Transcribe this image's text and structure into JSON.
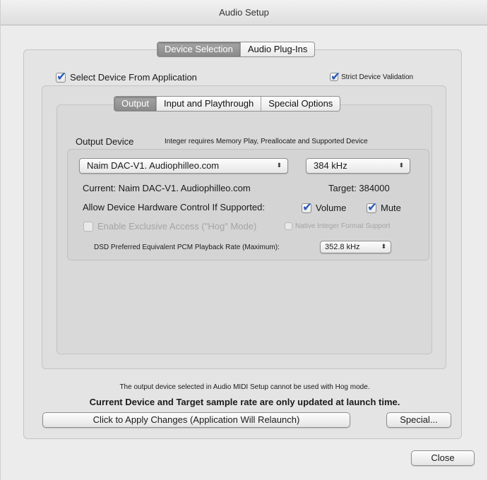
{
  "window": {
    "title": "Audio Setup"
  },
  "main_tabs": {
    "device_selection": "Device Selection",
    "audio_plugins": "Audio Plug-Ins"
  },
  "select_device_from_app": {
    "label": "Select Device From Application",
    "checked": true
  },
  "strict_validation": {
    "label": "Strict Device Validation",
    "checked": true
  },
  "sub_tabs": {
    "output": "Output",
    "input_playthrough": "Input and Playthrough",
    "special_options": "Special Options"
  },
  "output": {
    "heading": "Output Device",
    "integer_note": "Integer requires Memory Play, Preallocate and Supported Device",
    "device_popup": "Naim DAC-V1. Audiophilleo.com",
    "rate_popup": "384 kHz",
    "current_label": "Current: Naim DAC-V1. Audiophilleo.com",
    "target_label": "Target: 384000",
    "hw_control_label": "Allow Device Hardware Control If Supported:",
    "volume": {
      "label": "Volume",
      "checked": true
    },
    "mute": {
      "label": "Mute",
      "checked": true
    },
    "exclusive_access": {
      "label": "Enable Exclusive Access (\"Hog\" Mode)",
      "checked": false,
      "enabled": false
    },
    "native_integer": {
      "label": "Native Integer Format Support",
      "checked": false,
      "enabled": false
    },
    "dsd_label": "DSD Preferred Equivalent PCM Playback Rate (Maximum):",
    "dsd_popup": "352.8 kHz"
  },
  "notes": {
    "hog_note": "The output device selected in Audio MIDI Setup cannot be used with Hog mode.",
    "launch_note": "Current Device and Target sample rate are only updated at launch time."
  },
  "buttons": {
    "apply": "Click to Apply Changes (Application Will Relaunch)",
    "special": "Special...",
    "close": "Close"
  },
  "icons": {
    "check": "checkmark-icon",
    "popup_arrows": "up-down-arrows-icon"
  }
}
